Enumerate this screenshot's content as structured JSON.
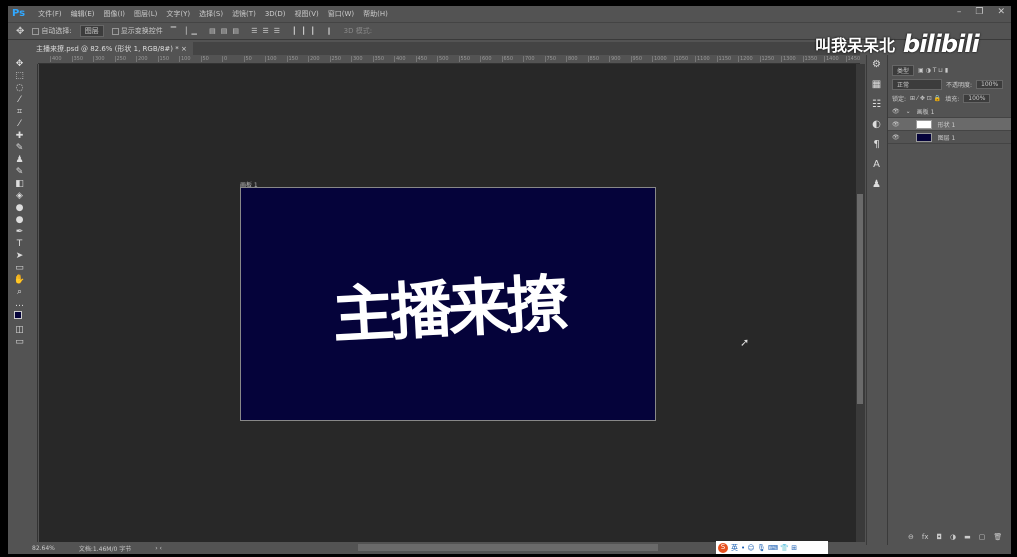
{
  "app": {
    "logo": "Ps",
    "menu": [
      "文件(F)",
      "编辑(E)",
      "图像(I)",
      "图层(L)",
      "文字(Y)",
      "选择(S)",
      "滤镜(T)",
      "3D(D)",
      "视图(V)",
      "窗口(W)",
      "帮助(H)"
    ]
  },
  "options": {
    "auto_select_label": "自动选择:",
    "auto_select_value": "图层",
    "show_transform": "显示变换控件",
    "mode_3d": "3D 模式:"
  },
  "tab": {
    "title": "主播来撩.psd @ 82.6% (形状 1, RGB/8#) *",
    "close": "×"
  },
  "ruler": [
    "400",
    "350",
    "300",
    "250",
    "200",
    "150",
    "100",
    "50",
    "0",
    "50",
    "100",
    "150",
    "200",
    "250",
    "300",
    "350",
    "400",
    "450",
    "500",
    "550",
    "600",
    "650",
    "700",
    "750",
    "800",
    "850",
    "900",
    "950",
    "1000",
    "1050",
    "1100",
    "1150",
    "1200",
    "1250",
    "1300",
    "1350",
    "1400",
    "1450"
  ],
  "artboard": {
    "label": "画板 1",
    "text": "主播来撩",
    "color": "#05033a"
  },
  "status": {
    "zoom": "82.64%",
    "doc": "文档:1.46M/0 字节"
  },
  "layers": {
    "filter": "类型",
    "blend": "正常",
    "opacity_label": "不透明度:",
    "opacity": "100%",
    "lock_label": "锁定:",
    "fill_label": "填充:",
    "fill": "100%",
    "items": [
      {
        "name": "画板 1",
        "kind": "group"
      },
      {
        "name": "形状 1",
        "kind": "shape",
        "selected": true
      },
      {
        "name": "图层 1",
        "kind": "fill"
      }
    ]
  },
  "ime": {
    "lang": "英"
  },
  "watermark": {
    "author": "叫我呆呆北",
    "site": "bilibili"
  }
}
